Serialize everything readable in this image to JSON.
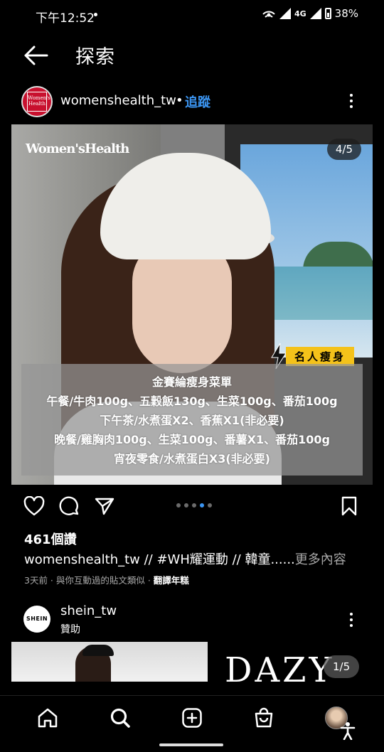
{
  "status_bar": {
    "time": "下午12:52",
    "network": "4G",
    "battery": "38%"
  },
  "header": {
    "title": "探索",
    "back_icon": "arrow-left-icon"
  },
  "post": {
    "username": "womenshealth_tw",
    "separator": "•",
    "follow_label": "追蹤",
    "image": {
      "brand_logo": "Women'sHealth",
      "counter": "4/5",
      "badge": "名人瘦身",
      "menu_lines": [
        "金賽綸瘦身菜單",
        "午餐/牛肉100g、五穀飯130g、生菜100g、番茄100g",
        "下午茶/水煮蛋X2、香蕉X1(非必要)",
        "晚餐/雞胸肉100g、生菜100g、番薯X1、番茄100g",
        "宵夜零食/水煮蛋白X3(非必要)"
      ]
    },
    "carousel": {
      "total": 5,
      "active": 4
    },
    "likes": "461個讚",
    "caption_user": "womenshealth_tw",
    "caption_text": " // #WH耀運動 // 韓童......",
    "caption_more": "更多內容",
    "meta_prefix": "3天前 · 與你互動過的貼文類似 · ",
    "meta_link": "翻譯年糕"
  },
  "post2": {
    "avatar_text": "SHEIN",
    "username": "shein_tw",
    "sponsored": "贊助",
    "image_brand": "DAZY",
    "counter": "1/5"
  },
  "nav": {
    "items": [
      "home-icon",
      "search-icon",
      "create-icon",
      "shop-icon",
      "profile-avatar"
    ]
  },
  "colors": {
    "accent": "#3b95f2",
    "badge_yellow": "#f4c21a",
    "background": "#000000"
  }
}
